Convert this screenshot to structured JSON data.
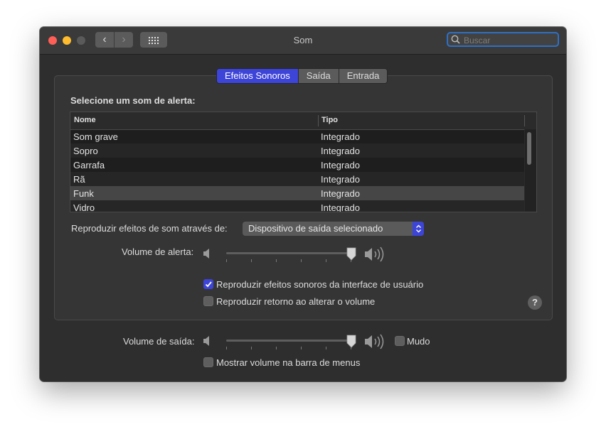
{
  "window": {
    "title": "Som",
    "search_placeholder": "Buscar"
  },
  "tabs": [
    {
      "label": "Efeitos Sonoros",
      "active": true
    },
    {
      "label": "Saída",
      "active": false
    },
    {
      "label": "Entrada",
      "active": false
    }
  ],
  "alert_section": {
    "heading": "Selecione um som de alerta:",
    "columns": [
      "Nome",
      "Tipo"
    ],
    "rows": [
      {
        "name": "Som grave",
        "type": "Integrado",
        "selected": false
      },
      {
        "name": "Sopro",
        "type": "Integrado",
        "selected": false
      },
      {
        "name": "Garrafa",
        "type": "Integrado",
        "selected": false
      },
      {
        "name": "Rã",
        "type": "Integrado",
        "selected": false
      },
      {
        "name": "Funk",
        "type": "Integrado",
        "selected": true
      },
      {
        "name": "Vidro",
        "type": "Integrado",
        "selected": false
      }
    ]
  },
  "play_through": {
    "label": "Reproduzir efeitos de som através de:",
    "selected": "Dispositivo de saída selecionado"
  },
  "alert_volume": {
    "label": "Volume de alerta:",
    "level": 1.0
  },
  "options": {
    "ui_sounds": {
      "label": "Reproduzir efeitos sonoros da interface de usuário",
      "checked": true
    },
    "feedback": {
      "label": "Reproduzir retorno ao alterar o volume",
      "checked": false
    }
  },
  "output_volume": {
    "label": "Volume de saída:",
    "level": 1.0,
    "mute_label": "Mudo",
    "mute_checked": false
  },
  "menu_bar": {
    "label": "Mostrar volume na barra de menus",
    "checked": false
  },
  "help_label": "?",
  "colors": {
    "accent": "#3d44d8",
    "window_bg": "#2e2e2e",
    "close": "#ff5f57",
    "minimize": "#febc2e"
  }
}
